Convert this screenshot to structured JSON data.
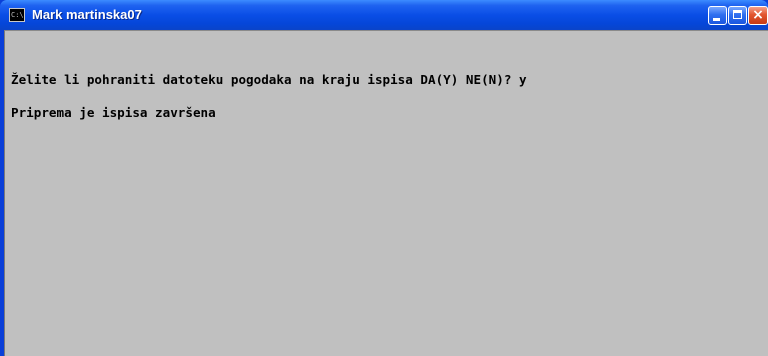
{
  "window": {
    "title": "Mark martinska07",
    "icon": "console-icon",
    "title_icon_text": "C:\\",
    "controls": {
      "minimize": "minimize-icon",
      "maximize": "maximize-icon",
      "close": "close-icon",
      "close_glyph": "×"
    },
    "colors": {
      "titlebar": "#0a4ee6",
      "console_background": "#c0c0c0",
      "console_text": "#000000"
    }
  },
  "console": {
    "lines": [
      "Želite li pohraniti datoteku pogodaka na kraju ispisa DA(Y) NE(N)? y",
      "Priprema je ispisa završena"
    ]
  }
}
